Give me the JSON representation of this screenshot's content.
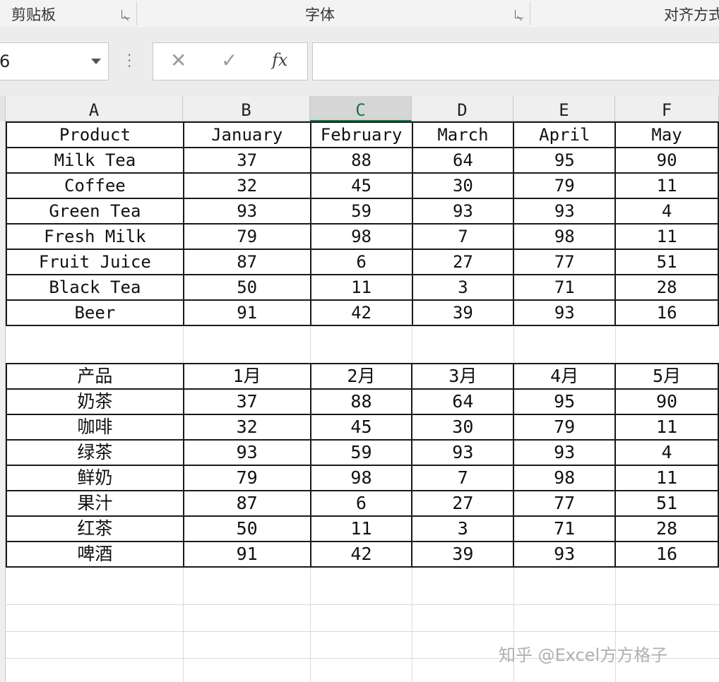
{
  "ribbon": {
    "groups": [
      "剪贴板",
      "字体",
      "对齐方式"
    ]
  },
  "formula_bar": {
    "name_box": "6",
    "cancel_symbol": "✕",
    "enter_symbol": "✓",
    "function_symbol": "fx",
    "formula": ""
  },
  "grid": {
    "columns": [
      "A",
      "B",
      "C",
      "D",
      "E",
      "F"
    ],
    "selected_column": "C"
  },
  "table_en": {
    "headers": [
      "Product",
      "January",
      "February",
      "March",
      "April",
      "May"
    ],
    "rows": [
      [
        "Milk Tea",
        "37",
        "88",
        "64",
        "95",
        "90"
      ],
      [
        "Coffee",
        "32",
        "45",
        "30",
        "79",
        "11"
      ],
      [
        "Green Tea",
        "93",
        "59",
        "93",
        "93",
        "4"
      ],
      [
        "Fresh Milk",
        "79",
        "98",
        "7",
        "98",
        "11"
      ],
      [
        "Fruit Juice",
        "87",
        "6",
        "27",
        "77",
        "51"
      ],
      [
        "Black Tea",
        "50",
        "11",
        "3",
        "71",
        "28"
      ],
      [
        "Beer",
        "91",
        "42",
        "39",
        "93",
        "16"
      ]
    ]
  },
  "table_zh": {
    "headers": [
      "产品",
      "1月",
      "2月",
      "3月",
      "4月",
      "5月"
    ],
    "rows": [
      [
        "奶茶",
        "37",
        "88",
        "64",
        "95",
        "90"
      ],
      [
        "咖啡",
        "32",
        "45",
        "30",
        "79",
        "11"
      ],
      [
        "绿茶",
        "93",
        "59",
        "93",
        "93",
        "4"
      ],
      [
        "鲜奶",
        "79",
        "98",
        "7",
        "98",
        "11"
      ],
      [
        "果汁",
        "87",
        "6",
        "27",
        "77",
        "51"
      ],
      [
        "红茶",
        "50",
        "11",
        "3",
        "71",
        "28"
      ],
      [
        "啤酒",
        "91",
        "42",
        "39",
        "93",
        "16"
      ]
    ]
  },
  "watermark": "知乎 @Excel方方格子"
}
